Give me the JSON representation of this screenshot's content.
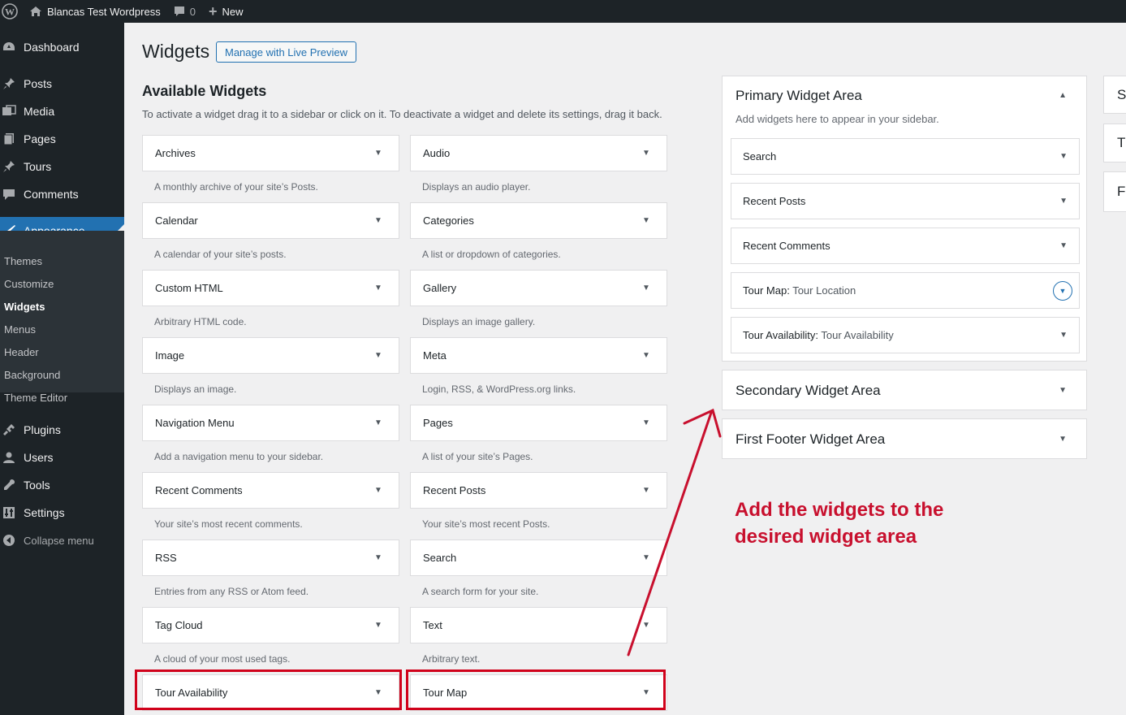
{
  "admin_bar": {
    "site_name": "Blancas Test Wordpress",
    "comments_count": "0",
    "new_label": "New"
  },
  "sidebar": {
    "items": [
      {
        "label": "Dashboard",
        "icon": "dashboard-icon"
      },
      {
        "label": "Posts",
        "icon": "pin-icon"
      },
      {
        "label": "Media",
        "icon": "media-icon"
      },
      {
        "label": "Pages",
        "icon": "pages-icon"
      },
      {
        "label": "Tours",
        "icon": "pin-icon"
      },
      {
        "label": "Comments",
        "icon": "comment-icon"
      },
      {
        "label": "Appearance",
        "icon": "brush-icon"
      },
      {
        "label": "Plugins",
        "icon": "plugin-icon"
      },
      {
        "label": "Users",
        "icon": "user-icon"
      },
      {
        "label": "Tools",
        "icon": "wrench-icon"
      },
      {
        "label": "Settings",
        "icon": "settings-icon"
      }
    ],
    "submenu": [
      "Themes",
      "Customize",
      "Widgets",
      "Menus",
      "Header",
      "Background",
      "Theme Editor"
    ],
    "collapse_label": "Collapse menu"
  },
  "page": {
    "title": "Widgets",
    "live_preview_label": "Manage with Live Preview",
    "available_title": "Available Widgets",
    "available_desc": "To activate a widget drag it to a sidebar or click on it. To deactivate a widget and delete its settings, drag it back."
  },
  "widgets": [
    {
      "name": "Archives",
      "desc": "A monthly archive of your site’s Posts."
    },
    {
      "name": "Audio",
      "desc": "Displays an audio player."
    },
    {
      "name": "Calendar",
      "desc": "A calendar of your site’s posts."
    },
    {
      "name": "Categories",
      "desc": "A list or dropdown of categories."
    },
    {
      "name": "Custom HTML",
      "desc": "Arbitrary HTML code."
    },
    {
      "name": "Gallery",
      "desc": "Displays an image gallery."
    },
    {
      "name": "Image",
      "desc": "Displays an image."
    },
    {
      "name": "Meta",
      "desc": "Login, RSS, & WordPress.org links."
    },
    {
      "name": "Navigation Menu",
      "desc": "Add a navigation menu to your sidebar."
    },
    {
      "name": "Pages",
      "desc": "A list of your site’s Pages."
    },
    {
      "name": "Recent Comments",
      "desc": "Your site’s most recent comments."
    },
    {
      "name": "Recent Posts",
      "desc": "Your site’s most recent Posts."
    },
    {
      "name": "RSS",
      "desc": "Entries from any RSS or Atom feed."
    },
    {
      "name": "Search",
      "desc": "A search form for your site."
    },
    {
      "name": "Tag Cloud",
      "desc": "A cloud of your most used tags."
    },
    {
      "name": "Text",
      "desc": "Arbitrary text."
    },
    {
      "name": "Tour Availability",
      "desc": ""
    },
    {
      "name": "Tour Map",
      "desc": ""
    }
  ],
  "widget_areas": {
    "primary": {
      "title": "Primary Widget Area",
      "desc": "Add widgets here to appear in your sidebar.",
      "widgets": [
        {
          "name": "Search",
          "sub": ""
        },
        {
          "name": "Recent Posts",
          "sub": ""
        },
        {
          "name": "Recent Comments",
          "sub": ""
        },
        {
          "name": "Tour Map:",
          "sub": "Tour Location"
        },
        {
          "name": "Tour Availability:",
          "sub": "Tour Availability"
        }
      ]
    },
    "secondary_title": "Secondary Widget Area",
    "footer_title": "First Footer Widget Area",
    "partial": [
      "Se",
      "Th",
      "Fo"
    ]
  },
  "annotation": {
    "line1": "Add the widgets to the",
    "line2": "desired widget area",
    "color": "#c8102e"
  }
}
